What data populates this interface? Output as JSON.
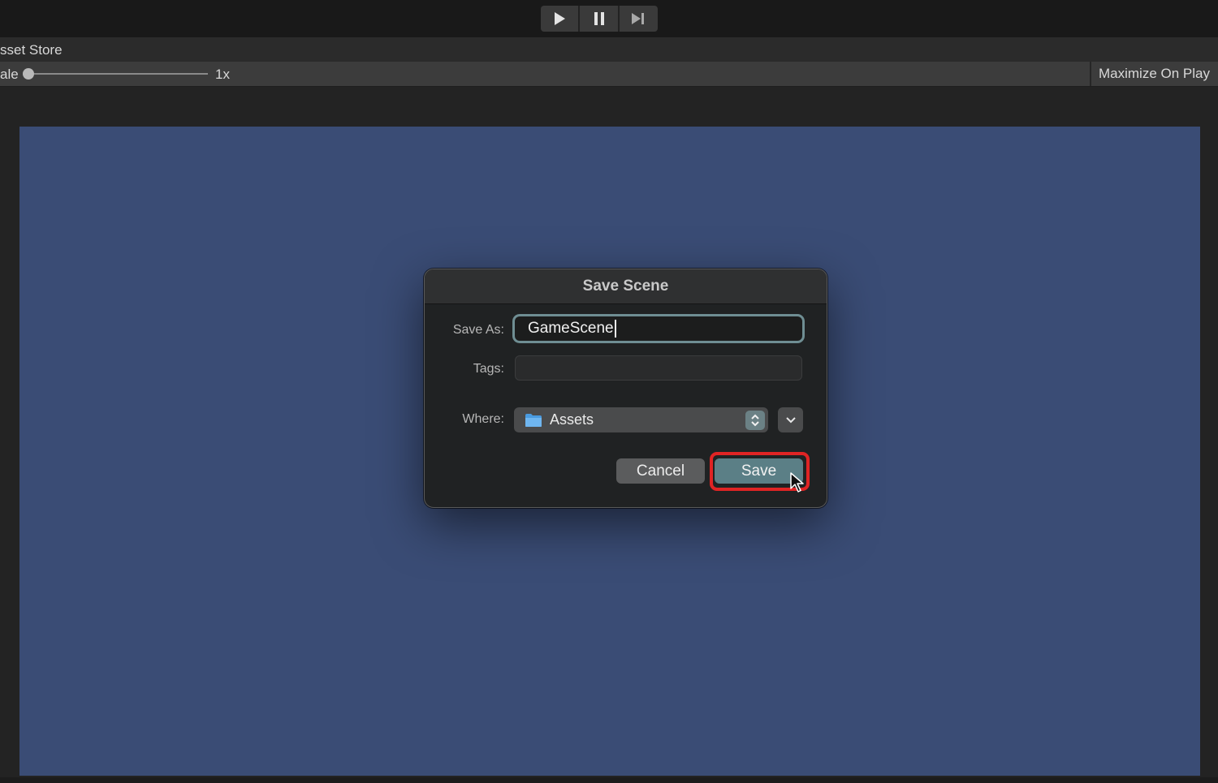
{
  "toolbar": {
    "play_icon": "play-icon",
    "pause_icon": "pause-icon",
    "step_icon": "step-icon"
  },
  "tabs": {
    "asset_store_label": "sset Store"
  },
  "game_toolbar": {
    "scale_label": "ale",
    "scale_value": "1x",
    "scale_fraction": 0.0,
    "maximize_label": "Maximize On Play"
  },
  "dialog": {
    "title": "Save Scene",
    "save_as_label": "Save As:",
    "save_as_value": "GameScene",
    "tags_label": "Tags:",
    "tags_value": "",
    "where_label": "Where:",
    "where_value": "Assets",
    "cancel_label": "Cancel",
    "save_label": "Save"
  },
  "colors": {
    "viewport_bg": "#3a4c75",
    "accent": "#5b7f86",
    "highlight": "#e02424"
  }
}
